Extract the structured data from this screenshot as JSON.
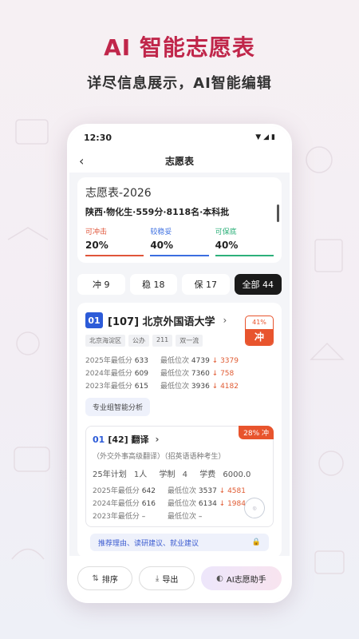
{
  "header": {
    "title": "AI 智能志愿表",
    "subtitle": "详尽信息展示，AI智能编辑"
  },
  "status_bar": {
    "time": "12:30"
  },
  "nav": {
    "title": "志愿表"
  },
  "summary": {
    "title": "志愿表-2026",
    "meta": "陕西·物化生·559分·8118名·本科批",
    "stats": [
      {
        "label": "可冲击",
        "value": "20%",
        "color": "#e0553a"
      },
      {
        "label": "较稳妥",
        "value": "40%",
        "color": "#3b6ee0"
      },
      {
        "label": "可保底",
        "value": "40%",
        "color": "#2db07a"
      }
    ]
  },
  "tabs": [
    {
      "label": "冲 9"
    },
    {
      "label": "稳 18"
    },
    {
      "label": "保 17"
    },
    {
      "label": "全部 44"
    }
  ],
  "university": {
    "index": "01",
    "name": "[107] 北京外国语大学",
    "tags": [
      "北京海淀区",
      "公办",
      "211",
      "双一流"
    ],
    "rows": [
      {
        "year_label": "2025年最低分",
        "score": "633",
        "rank_label": "最低位次",
        "rank": "4739",
        "delta": "↓ 3379"
      },
      {
        "year_label": "2024年最低分",
        "score": "609",
        "rank_label": "最低位次",
        "rank": "7360",
        "delta": "↓ 758"
      },
      {
        "year_label": "2023年最低分",
        "score": "615",
        "rank_label": "最低位次",
        "rank": "3936",
        "delta": "↓ 4182"
      }
    ],
    "badge_pct": "41%",
    "badge_type": "冲",
    "analysis_label": "专业组智能分析"
  },
  "major": {
    "index": "01",
    "name": "[42] 翻译",
    "desc": "（外交外事高级翻译）（招英语语种考生）",
    "plan_label": "25年计划",
    "plan_value": "1人",
    "duration_label": "学制",
    "duration_value": "4",
    "fee_label": "学费",
    "fee_value": "6000.0",
    "pct": "28% 冲",
    "rows": [
      {
        "year_label": "2025年最低分",
        "score": "642",
        "rank_label": "最低位次",
        "rank": "3537",
        "delta": "↓ 4581"
      },
      {
        "year_label": "2024年最低分",
        "score": "616",
        "rank_label": "最低位次",
        "rank": "6134",
        "delta": "↓ 1984"
      },
      {
        "year_label": "2023年最低分",
        "score": "–",
        "rank_label": "最低位次",
        "rank": "–",
        "delta": ""
      }
    ],
    "reason_label": "推荐理由、读研建议、就业建议"
  },
  "bottom": {
    "sort_label": "排序",
    "export_label": "导出",
    "ai_label": "AI志愿助手"
  }
}
